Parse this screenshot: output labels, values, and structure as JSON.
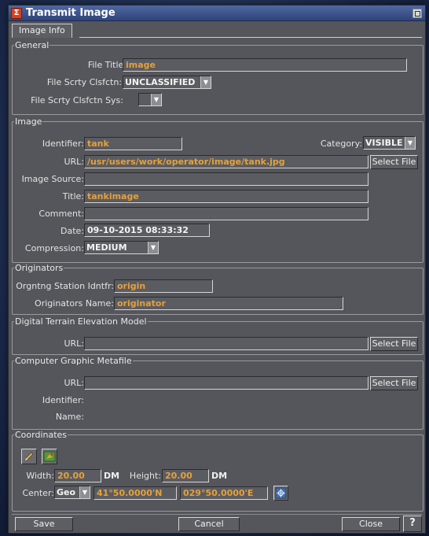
{
  "window": {
    "title": "Transmit Image"
  },
  "tabs": [
    {
      "label": "Image Info"
    }
  ],
  "general": {
    "legend": "General",
    "file_title_label": "File Title:",
    "file_title_value": "image",
    "file_scrty_label": "File Scrty Clsfctn:",
    "file_scrty_value": "UNCLASSIFIED",
    "file_scrty_sys_label": "File Scrty Clsfctn Sys:",
    "file_scrty_sys_value": ""
  },
  "image": {
    "legend": "Image",
    "identifier_label": "Identifier:",
    "identifier_value": "tank",
    "category_label": "Category:",
    "category_value": "VISIBLE",
    "url_label": "URL:",
    "url_value": "/usr/users/work/operator/image/tank.jpg",
    "select_file_label": "Select File",
    "image_source_label": "Image Source:",
    "image_source_value": "",
    "title_label": "Title:",
    "title_value": "tankimage",
    "comment_label": "Comment:",
    "comment_value": "",
    "date_label": "Date:",
    "date_value": "09-10-2015 08:33:32",
    "compression_label": "Compression:",
    "compression_value": "MEDIUM"
  },
  "originators": {
    "legend": "Originators",
    "station_label": "Orgntng Station Idntfr:",
    "station_value": "origin",
    "name_label": "Originators Name:",
    "name_value": "originator"
  },
  "dtem": {
    "legend": "Digital Terrain Elevation Model",
    "url_label": "URL:",
    "url_value": "",
    "select_file_label": "Select File"
  },
  "cgm": {
    "legend": "Computer Graphic Metafile",
    "url_label": "URL:",
    "url_value": "",
    "select_file_label": "Select File",
    "identifier_label": "Identifier:",
    "name_label": "Name:"
  },
  "coordinates": {
    "legend": "Coordinates",
    "width_label": "Width:",
    "width_value": "20.00",
    "width_unit": "DM",
    "height_label": "Height:",
    "height_value": "20.00",
    "height_unit": "DM",
    "center_label": "Center:",
    "center_mode": "Geo",
    "latitude": "41°50.0000'N",
    "longitude": "029°50.0000'E"
  },
  "footer": {
    "save_label": "Save",
    "cancel_label": "Cancel",
    "close_label": "Close",
    "help_label": "?"
  },
  "colors": {
    "window_bg": "#55565b",
    "value_text": "#e5a13a",
    "titlebar": "#3b5187"
  }
}
